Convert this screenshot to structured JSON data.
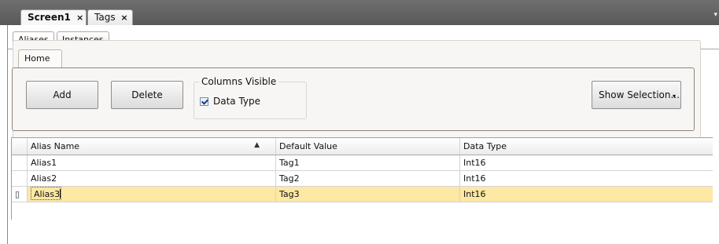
{
  "doc_tabs": [
    {
      "label": "Screen1",
      "close": "×",
      "active": true
    },
    {
      "label": "Tags",
      "close": "×",
      "active": false
    }
  ],
  "overflow_icon": "▾",
  "sub_tabs": [
    {
      "label": "Aliases",
      "active": true
    },
    {
      "label": "Instances",
      "active": false
    }
  ],
  "ribbon": {
    "tab": "Home",
    "add_label": "Add",
    "delete_label": "Delete",
    "columns_visible_title": "Columns Visible",
    "data_type_checkbox": {
      "label": "Data Type",
      "checked": true
    },
    "show_selection_label": "Show Selection...",
    "show_selection_caret": "▾"
  },
  "grid": {
    "columns": [
      "Alias Name",
      "Default Value",
      "Data Type"
    ],
    "sort_indicator": "▲",
    "rows": [
      {
        "alias": "Alias1",
        "default_value": "Tag1",
        "data_type": "Int16",
        "selected": false
      },
      {
        "alias": "Alias2",
        "default_value": "Tag2",
        "data_type": "Int16",
        "selected": false
      },
      {
        "alias": "Alias3",
        "default_value": "Tag3",
        "data_type": "Int16",
        "selected": true
      }
    ],
    "edit_row_indicator": "▯"
  },
  "colors": {
    "selection": "#fde8a4",
    "tabbar": "#666666"
  }
}
